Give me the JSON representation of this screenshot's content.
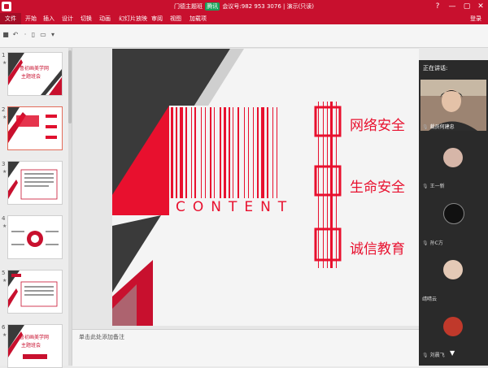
{
  "titlebar": {
    "title_left": "门德主题班",
    "meeting_badge": "腾讯",
    "title_right": "会议号:982 953 3076 | 演示(只读)",
    "help": "?",
    "minimize": "—",
    "maximize": "▢",
    "close": "✕"
  },
  "ribbon": {
    "file": "文件",
    "tabs": [
      "开始",
      "插入",
      "设计",
      "切换",
      "动画",
      "幻灯片放映",
      "审阅",
      "视图",
      "加载项"
    ],
    "login": "登录"
  },
  "slides_panel": {
    "numbers": [
      "1",
      "2",
      "3",
      "4",
      "5",
      "6"
    ],
    "thumb1_line1": "鲁初画美学网",
    "thumb1_line2": "主题班会",
    "thumb6_line1": "鲁初画美学网",
    "thumb6_line2": "主题班会"
  },
  "slide": {
    "content_word": "CONTENT",
    "items": [
      "网络安全",
      "生命安全",
      "诚信教育"
    ]
  },
  "notes": {
    "placeholder": "单击此处添加备注"
  },
  "video_panel": {
    "speaking_label": "正在讲话:",
    "speaker_name": "裁员何建忠",
    "participants": [
      "王一新",
      "孙C方",
      "靖晴云",
      "刘晨飞"
    ]
  },
  "colors": {
    "accent_red": "#c8102e",
    "slide_dark": "#3a3a3a"
  }
}
